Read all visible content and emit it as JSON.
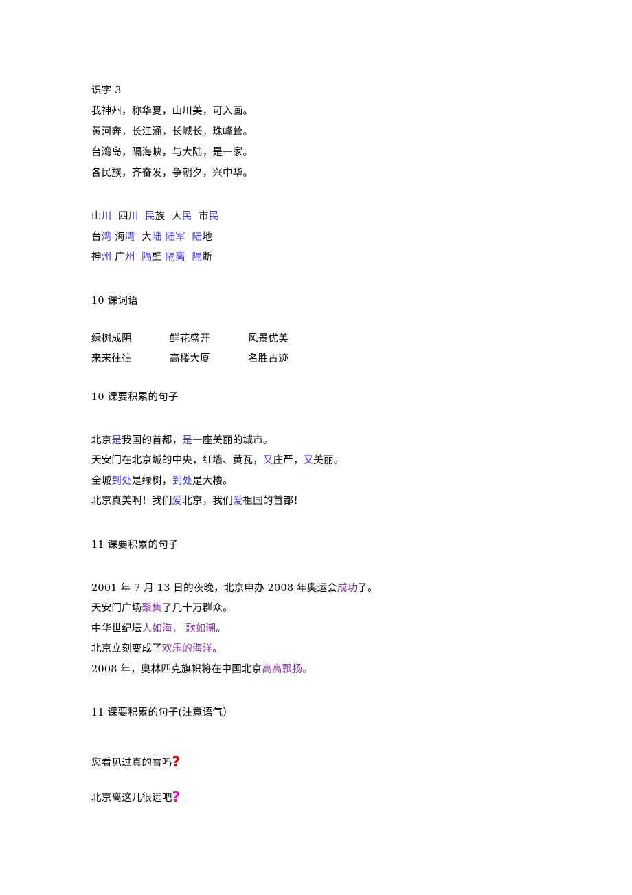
{
  "document": {
    "title": "识字3",
    "background_color": "#ffffff",
    "text_color": "#000000",
    "accent_blue": "#3333ff",
    "accent_purple": "#8833aa",
    "accent_red": "#ee0000",
    "accent_pink": "#ff00cc"
  },
  "sections": {
    "shizi3": {
      "heading": "识字 3",
      "lines": [
        "我神州，称华夏，山川美，可入画。",
        "黄河奔，长江涌，长城长，珠峰耸。",
        "台湾岛，隔海峡，与大陆，是一家。",
        "各民族，齐奋发，争朝夕，兴中华。"
      ]
    },
    "wordlist": {
      "rows": [
        {
          "groups": [
            {
              "parts": [
                {
                  "text": "山",
                  "color": "black"
                },
                {
                  "text": "川",
                  "color": "blue"
                }
              ]
            },
            {
              "parts": [
                {
                  "text": "四",
                  "color": "black"
                },
                {
                  "text": "川",
                  "color": "blue"
                }
              ]
            },
            {
              "parts": [
                {
                  "text": "民",
                  "color": "blue"
                },
                {
                  "text": "族",
                  "color": "black"
                }
              ]
            },
            {
              "parts": [
                {
                  "text": "人",
                  "color": "black"
                },
                {
                  "text": "民",
                  "color": "blue"
                }
              ]
            },
            {
              "parts": [
                {
                  "text": "市",
                  "color": "black"
                },
                {
                  "text": "民",
                  "color": "blue"
                }
              ]
            }
          ]
        },
        {
          "groups": [
            {
              "parts": [
                {
                  "text": "台",
                  "color": "black"
                },
                {
                  "text": "湾",
                  "color": "blue"
                }
              ]
            },
            {
              "parts": [
                {
                  "text": "海",
                  "color": "black"
                },
                {
                  "text": "湾",
                  "color": "blue"
                }
              ]
            },
            {
              "parts": [
                {
                  "text": "大",
                  "color": "black"
                },
                {
                  "text": "陆",
                  "color": "blue"
                }
              ]
            },
            {
              "parts": [
                {
                  "text": "陆军",
                  "color": "blue"
                }
              ]
            },
            {
              "parts": [
                {
                  "text": "陆",
                  "color": "blue"
                },
                {
                  "text": "地",
                  "color": "black"
                }
              ]
            }
          ]
        },
        {
          "groups": [
            {
              "parts": [
                {
                  "text": "神",
                  "color": "black"
                },
                {
                  "text": "州",
                  "color": "blue"
                }
              ]
            },
            {
              "parts": [
                {
                  "text": "广",
                  "color": "black"
                },
                {
                  "text": "州",
                  "color": "blue"
                }
              ]
            },
            {
              "parts": [
                {
                  "text": "隔",
                  "color": "blue"
                },
                {
                  "text": "壁",
                  "color": "black"
                }
              ]
            },
            {
              "parts": [
                {
                  "text": "隔离",
                  "color": "blue"
                }
              ]
            },
            {
              "parts": [
                {
                  "text": "隔",
                  "color": "blue"
                },
                {
                  "text": "断",
                  "color": "black"
                }
              ]
            }
          ]
        }
      ]
    },
    "lesson10_words": {
      "heading": "10 课词语",
      "rows": [
        [
          "绿树成阴",
          "鲜花盛开",
          "风景优美"
        ],
        [
          "来来往往",
          "高楼大厦",
          "名胜古迹"
        ]
      ]
    },
    "lesson10_sentences": {
      "heading": "10 课要积累的句子",
      "lines": [
        [
          {
            "text": "北京",
            "color": "black"
          },
          {
            "text": "是",
            "color": "blue"
          },
          {
            "text": "我国的首都，",
            "color": "black"
          },
          {
            "text": "是",
            "color": "blue"
          },
          {
            "text": "一座美丽的城市。",
            "color": "black"
          }
        ],
        [
          {
            "text": "天安门在北京城的中央，红墙、黄瓦，",
            "color": "black"
          },
          {
            "text": "又",
            "color": "blue"
          },
          {
            "text": "庄严，",
            "color": "black"
          },
          {
            "text": "又",
            "color": "blue"
          },
          {
            "text": "美丽。",
            "color": "black"
          }
        ],
        [
          {
            "text": "全城",
            "color": "black"
          },
          {
            "text": "到处",
            "color": "blue"
          },
          {
            "text": "是绿树，",
            "color": "black"
          },
          {
            "text": "到处",
            "color": "blue"
          },
          {
            "text": "是大楼。",
            "color": "black"
          }
        ],
        [
          {
            "text": "北京真美啊！我们",
            "color": "black"
          },
          {
            "text": "爱",
            "color": "blue"
          },
          {
            "text": "北京，我们",
            "color": "black"
          },
          {
            "text": "爱",
            "color": "blue"
          },
          {
            "text": "祖国的首都！",
            "color": "black"
          }
        ]
      ]
    },
    "lesson11_sentences": {
      "heading": "11 课要积累的句子",
      "lines": [
        [
          {
            "text": "2001 年 7 月 13 日的夜晚，北京申办 2008 年奥运会",
            "color": "black"
          },
          {
            "text": "成功",
            "color": "purple"
          },
          {
            "text": "了。",
            "color": "black"
          }
        ],
        [
          {
            "text": "天安门广场",
            "color": "black"
          },
          {
            "text": "聚集",
            "color": "purple"
          },
          {
            "text": "了几十万群众。",
            "color": "black"
          }
        ],
        [
          {
            "text": "中华世纪坛",
            "color": "black"
          },
          {
            "text": "人如海，",
            "color": "purple"
          },
          {
            "text": " ",
            "color": "black"
          },
          {
            "text": "歌如潮",
            "color": "purple"
          },
          {
            "text": "。",
            "color": "black"
          }
        ],
        [
          {
            "text": "北京立刻变成了",
            "color": "black"
          },
          {
            "text": "欢乐的海洋",
            "color": "purple"
          },
          {
            "text": "。",
            "color": "black"
          }
        ],
        [
          {
            "text": "2008 年，奥林匹克旗帜将在中国北京",
            "color": "black"
          },
          {
            "text": "高高飘扬",
            "color": "purple"
          },
          {
            "text": "。",
            "color": "purple"
          }
        ]
      ]
    },
    "lesson11_tone": {
      "heading": "11 课要积累的句子(注意语气）",
      "lines": [
        {
          "text": "您看见过真的雪吗",
          "mark": "?",
          "mark_color": "red"
        },
        {
          "text": "北京离这儿很远吧",
          "mark": "?",
          "mark_color": "pink"
        }
      ]
    }
  }
}
